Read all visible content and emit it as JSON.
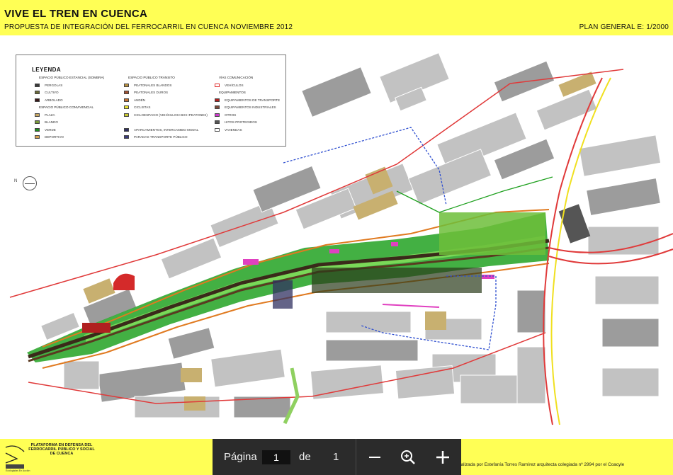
{
  "header": {
    "title": "VIVE EL TREN EN CUENCA",
    "subtitle": "PROPUESTA DE INTEGRACIÓN DEL FERROCARRIL EN CUENCA NOVIEMBRE 2012",
    "scale": "PLAN GENERAL E: 1/2000"
  },
  "legend": {
    "title": "LEYENDA",
    "col1": [
      {
        "label": "ESPACIO PÚBLICO ESTANCIAL (SOMBRA)",
        "type": "head"
      },
      {
        "label": "PERGOLAS",
        "type": "item",
        "color": "#3a3a3a"
      },
      {
        "label": "CULTIVO",
        "type": "item",
        "color": "#6b6b3a"
      },
      {
        "label": "ARBOLADO",
        "type": "item",
        "color": "#3a1a1a"
      },
      {
        "label": "ESPACIO PÚBLICO CONVIVENCIAL",
        "type": "head"
      },
      {
        "label": "PLAZA",
        "type": "item",
        "color": "#c8a864"
      },
      {
        "label": "BLANDO",
        "type": "item",
        "color": "#7a9a3a"
      },
      {
        "label": "VERDE",
        "type": "item",
        "color": "#1e8c1e"
      },
      {
        "label": "DEPORTIVO",
        "type": "item",
        "color": "#d4a050"
      }
    ],
    "col2": [
      {
        "label": "ESPACIO PÚBLICO TRÁNSITO",
        "type": "head"
      },
      {
        "label": "PEATONALES BLANDOS",
        "type": "item",
        "color": "#b89040"
      },
      {
        "label": "PEATONALES DUROS",
        "type": "item",
        "color": "#a05030"
      },
      {
        "label": "ANDÉN",
        "type": "item",
        "color": "#c07030"
      },
      {
        "label": "CICLISTAS",
        "type": "item",
        "color": "#e8e030"
      },
      {
        "label": "CICLOESPACIO (VEHÍCULOS+BICI+PEATONES)",
        "type": "item",
        "color": "#c8c830"
      },
      {
        "label": "",
        "type": "blank"
      },
      {
        "label": "APARCAMIENTOS, INTERCAMBIO MODAL",
        "type": "item",
        "color": "#303060"
      },
      {
        "label": "PARADAS TRANSPORTE PÚBLICO",
        "type": "item",
        "color": "#3a3a7a"
      }
    ],
    "col3": [
      {
        "label": "VÍAS COMUNICACIÓN",
        "type": "head"
      },
      {
        "label": "VEHÍCULOS",
        "type": "item",
        "color": "#ffffff",
        "border": "#e03030"
      },
      {
        "label": "EQUIPAMIENTOS",
        "type": "head"
      },
      {
        "label": "EQUIPAMIENTOS DE TRANSPORTE",
        "type": "item",
        "color": "#b02020"
      },
      {
        "label": "EQUIPAMIENTOS INDUSTRIALES",
        "type": "item",
        "color": "#7a4a3a"
      },
      {
        "label": "OTROS",
        "type": "item",
        "color": "#d03ad0"
      },
      {
        "label": "HITOS PROTEGIDOS",
        "type": "item",
        "color": "#555555"
      },
      {
        "label": "VIVIENDAS",
        "type": "item",
        "color": "#ffffff",
        "border": "#555555"
      }
    ]
  },
  "map": {
    "north_label": "N",
    "colors": {
      "block": "#c2c2c2",
      "block_dark": "#9c9c9c",
      "road_red": "#e03a3a",
      "green": "#1ea01e",
      "green_light": "#6fd04a",
      "track_dark": "#3a2a1a",
      "orange": "#e07a20",
      "yellow": "#f0e020",
      "magenta": "#e040c0",
      "blue": "#3050d0",
      "beige": "#c8b070"
    }
  },
  "footer": {
    "logo_text": "PLATAFORMA EN DEFENSA DEL FERROCARRIL PÚBLICO Y SOCIAL DE CUENCA",
    "logo_sub": "Ecologistas En Acción",
    "credit": "Propuesta realizada por Estefanía Torres Ramírez arquitecta colegiada nº 2994 por el Coacyle"
  },
  "pager": {
    "page_label": "Página",
    "current_page": "1",
    "of_label": "de",
    "total_pages": "1",
    "zoom_out_icon": "minus-icon",
    "zoom_fit_icon": "zoom-search-icon",
    "zoom_in_icon": "plus-icon"
  }
}
